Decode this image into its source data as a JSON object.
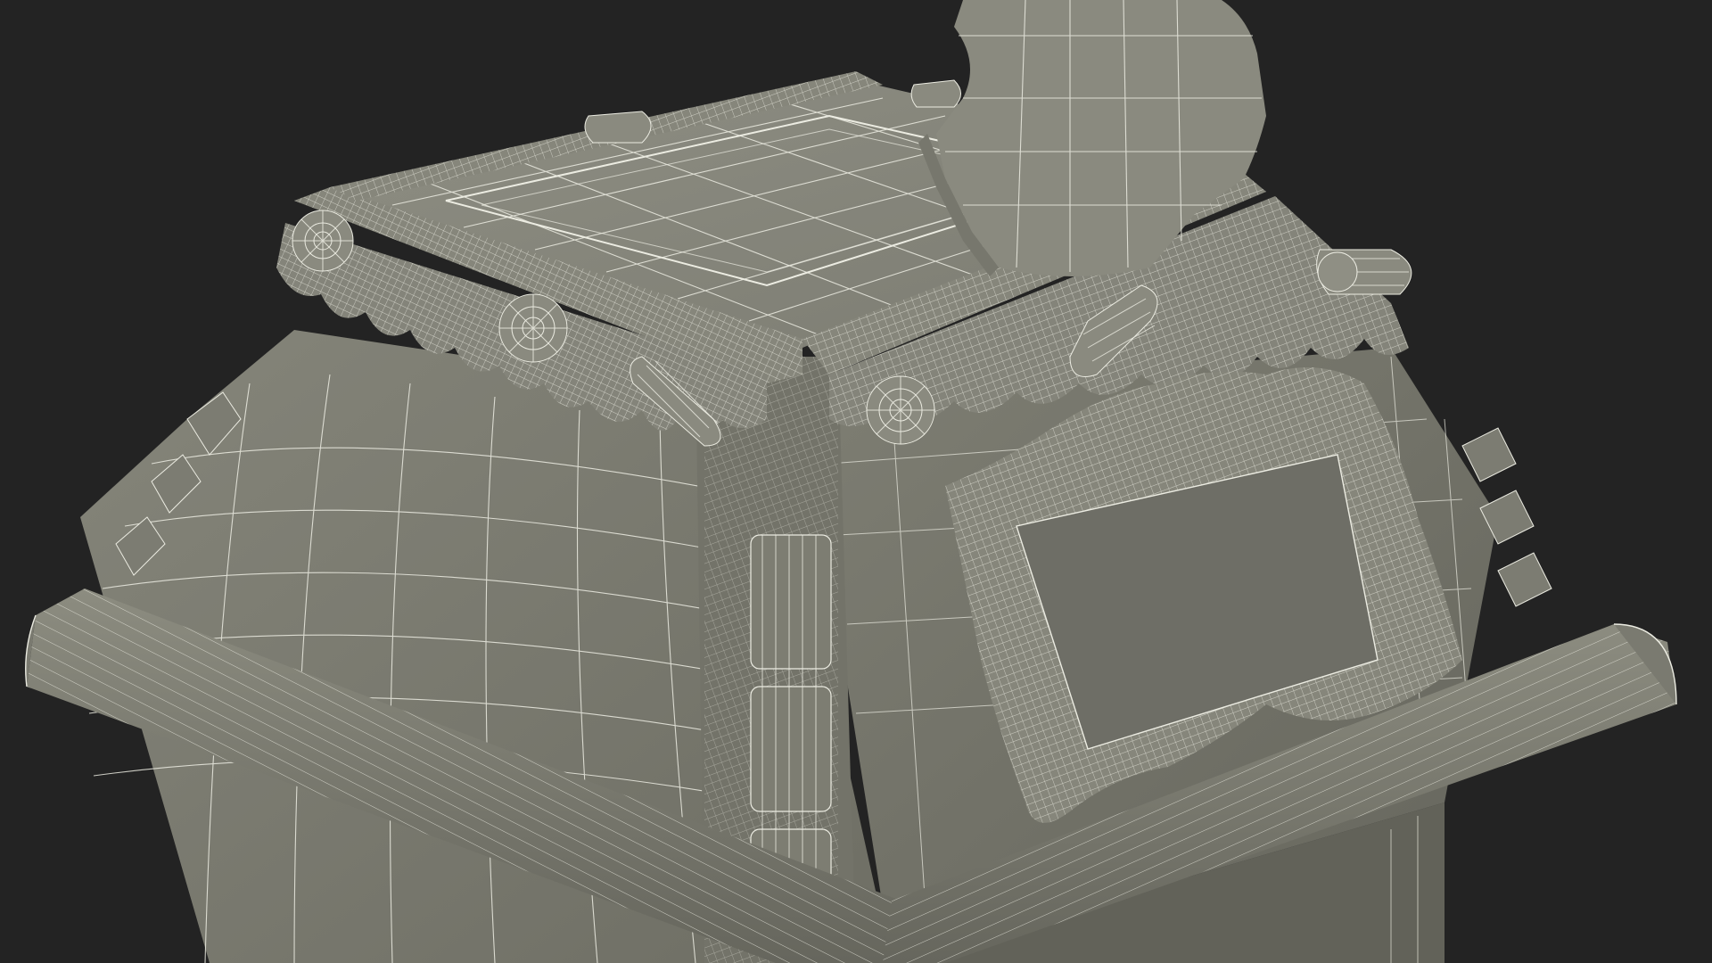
{
  "scene": {
    "subject": "wireframe-3d-model",
    "colors": {
      "background": "#232323",
      "surface_light": "#8a8a7e",
      "surface_mid": "#76766b",
      "surface_dark": "#5c5c53",
      "wire": "#e6e6dc",
      "plaque_inner": "#6e6e66"
    }
  }
}
